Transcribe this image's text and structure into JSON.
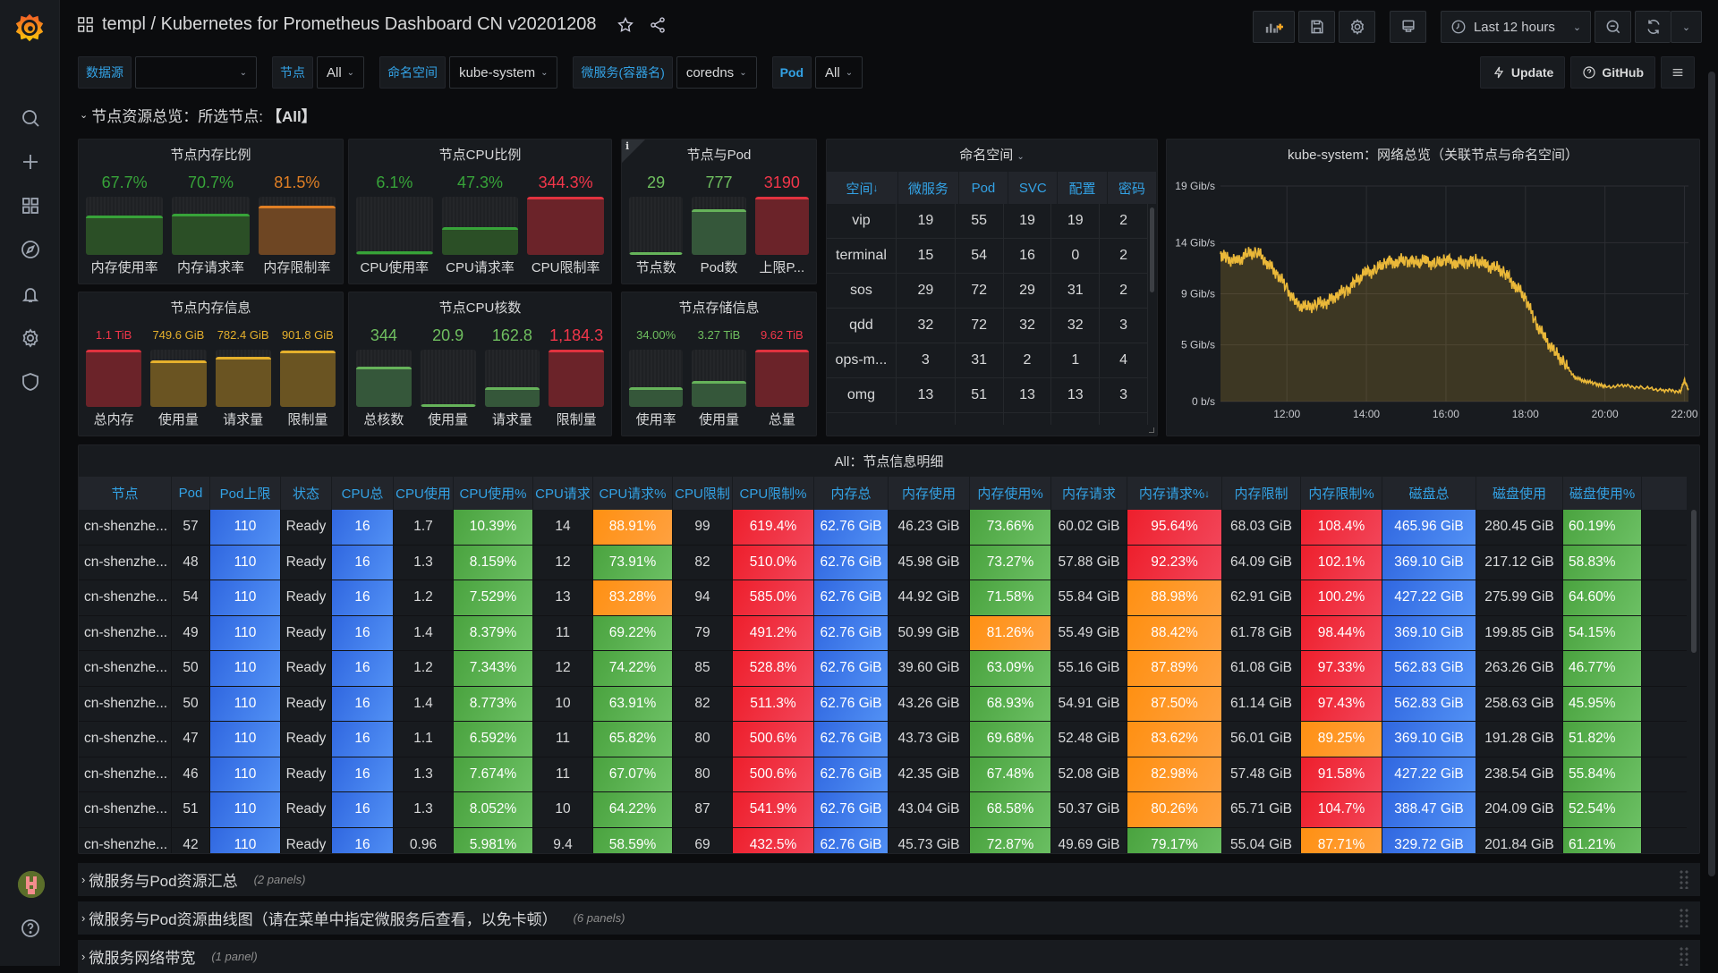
{
  "header": {
    "breadcrumb": "templ / Kubernetes for Prometheus Dashboard CN v20201208",
    "time_range": "Last 12 hours"
  },
  "sidebar": {
    "items": [
      "search",
      "create",
      "dashboards",
      "explore",
      "alerting",
      "configuration",
      "server-admin"
    ],
    "help": "help"
  },
  "variables": [
    {
      "label": "数据源",
      "value": ""
    },
    {
      "label": "节点",
      "value": "All"
    },
    {
      "label": "命名空间",
      "value": "kube-system"
    },
    {
      "label": "微服务(容器名)",
      "value": "coredns"
    },
    {
      "label": "Pod",
      "value": "All"
    }
  ],
  "links": {
    "update": "Update",
    "github": "GitHub"
  },
  "row": {
    "title_prefix": "节点资源总览：所选节点:",
    "title_value": "【All】"
  },
  "mem_ratio": {
    "title": "节点内存比例",
    "bars": [
      {
        "label": "内存使用率",
        "value": "67.7%",
        "fraction": 0.677,
        "color": "green"
      },
      {
        "label": "内存请求率",
        "value": "70.7%",
        "fraction": 0.707,
        "color": "green"
      },
      {
        "label": "内存限制率",
        "value": "81.5%",
        "fraction": 0.85,
        "color": "orange"
      }
    ]
  },
  "cpu_ratio": {
    "title": "节点CPU比例",
    "bars": [
      {
        "label": "CPU使用率",
        "value": "6.1%",
        "fraction": 0.061,
        "color": "green"
      },
      {
        "label": "CPU请求率",
        "value": "47.3%",
        "fraction": 0.473,
        "color": "green"
      },
      {
        "label": "CPU限制率",
        "value": "344.3%",
        "fraction": 1.0,
        "color": "red"
      }
    ]
  },
  "node_pod": {
    "title": "节点与Pod",
    "bars": [
      {
        "label": "节点数",
        "value": "29",
        "fraction": 0.02,
        "color": "green2"
      },
      {
        "label": "Pod数",
        "value": "777",
        "fraction": 0.78,
        "color": "green2"
      },
      {
        "label": "上限P...",
        "value": "3190",
        "fraction": 1.0,
        "color": "red"
      }
    ]
  },
  "mem_info": {
    "title": "节点内存信息",
    "bars": [
      {
        "label": "总内存",
        "value": "1.1 TiB",
        "fraction": 1.0,
        "color": "red"
      },
      {
        "label": "使用量",
        "value": "749.6 GiB",
        "fraction": 0.82,
        "color": "yellow"
      },
      {
        "label": "请求量",
        "value": "782.4 GiB",
        "fraction": 0.87,
        "color": "yellow"
      },
      {
        "label": "限制量",
        "value": "901.8 GiB",
        "fraction": 0.98,
        "color": "yellow"
      }
    ]
  },
  "cpu_cores": {
    "title": "节点CPU核数",
    "bars": [
      {
        "label": "总核数",
        "value": "344",
        "fraction": 0.71,
        "color": "green2"
      },
      {
        "label": "使用量",
        "value": "20.9",
        "fraction": 0.04,
        "color": "green2"
      },
      {
        "label": "请求量",
        "value": "162.8",
        "fraction": 0.34,
        "color": "green2"
      },
      {
        "label": "限制量",
        "value": "1,184.3",
        "fraction": 1.0,
        "color": "red"
      }
    ]
  },
  "storage": {
    "title": "节点存储信息",
    "bars": [
      {
        "label": "使用率",
        "value": "34.00%",
        "fraction": 0.34,
        "color": "green2"
      },
      {
        "label": "使用量",
        "value": "3.27 TiB",
        "fraction": 0.45,
        "color": "green2"
      },
      {
        "label": "总量",
        "value": "9.62 TiB",
        "fraction": 1.0,
        "color": "red"
      }
    ]
  },
  "namespace_table": {
    "title": "命名空间",
    "columns": [
      "空间",
      "微服务",
      "Pod",
      "SVC",
      "配置",
      "密码"
    ],
    "sort_column": "空间",
    "rows": [
      [
        "vip",
        "19",
        "55",
        "19",
        "19",
        "2"
      ],
      [
        "terminal",
        "15",
        "54",
        "16",
        "0",
        "2"
      ],
      [
        "sos",
        "29",
        "72",
        "29",
        "31",
        "2"
      ],
      [
        "qdd",
        "32",
        "72",
        "32",
        "32",
        "3"
      ],
      [
        "ops-m...",
        "3",
        "31",
        "2",
        "1",
        "4"
      ],
      [
        "omg",
        "13",
        "51",
        "13",
        "13",
        "3"
      ]
    ]
  },
  "chart_data": {
    "type": "area",
    "title": "kube-system：网络总览（关联节点与命名空间）",
    "xlabel": "",
    "ylabel": "",
    "x_ticks": [
      "12:00",
      "14:00",
      "16:00",
      "18:00",
      "20:00",
      "22:00"
    ],
    "y_ticks": [
      "0 b/s",
      "5 Gib/s",
      "9 Gib/s",
      "14 Gib/s",
      "19 Gib/s"
    ],
    "ylim": [
      0,
      19
    ],
    "xlim_hours": [
      10.33,
      22.1
    ],
    "grid": true,
    "legend": "none",
    "series": [
      {
        "name": "network",
        "color": "#eab839",
        "x_hours": [
          10.33,
          10.5,
          10.75,
          11.0,
          11.25,
          11.5,
          11.75,
          12.0,
          12.25,
          12.5,
          12.75,
          13.0,
          13.25,
          13.5,
          13.75,
          14.0,
          14.25,
          14.5,
          14.75,
          15.0,
          15.25,
          15.5,
          15.75,
          16.0,
          16.25,
          16.5,
          16.75,
          17.0,
          17.25,
          17.5,
          17.75,
          18.0,
          18.25,
          18.5,
          18.75,
          19.0,
          19.25,
          19.5,
          19.75,
          20.0,
          20.5,
          21.0,
          21.5,
          21.9,
          22.0,
          22.1
        ],
        "values": [
          13.0,
          12.6,
          12.3,
          13.0,
          13.2,
          12.3,
          11.3,
          10.0,
          8.5,
          8.3,
          8.6,
          8.8,
          9.4,
          9.8,
          10.6,
          11.4,
          11.6,
          12.4,
          12.3,
          12.5,
          12.2,
          12.4,
          12.1,
          12.6,
          12.2,
          12.3,
          12.4,
          12.0,
          11.8,
          11.3,
          10.2,
          9.2,
          7.0,
          5.5,
          4.3,
          3.3,
          2.1,
          1.8,
          1.6,
          1.3,
          1.4,
          1.2,
          1.0,
          0.9,
          1.9,
          1.0
        ]
      }
    ]
  },
  "node_table": {
    "title": "All：节点信息明细",
    "columns": [
      "节点",
      "Pod",
      "Pod上限",
      "状态",
      "CPU总",
      "CPU使用",
      "CPU使用%",
      "CPU请求",
      "CPU请求%",
      "CPU限制",
      "CPU限制%",
      "内存总",
      "内存使用",
      "内存使用%",
      "内存请求",
      "内存请求%",
      "内存限制",
      "内存限制%",
      "磁盘总",
      "磁盘使用",
      "磁盘使用%"
    ],
    "sort_column": "内存请求%",
    "rows": [
      [
        "cn-shenzhe...",
        "57",
        "110",
        "Ready",
        "16",
        "1.7",
        "10.39%",
        "14",
        "88.91%",
        "99",
        "619.4%",
        "62.76 GiB",
        "46.23 GiB",
        "73.66%",
        "60.02 GiB",
        "95.64%",
        "68.03 GiB",
        "108.4%",
        "465.96 GiB",
        "280.45 GiB",
        "60.19%"
      ],
      [
        "cn-shenzhe...",
        "48",
        "110",
        "Ready",
        "16",
        "1.3",
        "8.159%",
        "12",
        "73.91%",
        "82",
        "510.0%",
        "62.76 GiB",
        "45.98 GiB",
        "73.27%",
        "57.88 GiB",
        "92.23%",
        "64.09 GiB",
        "102.1%",
        "369.10 GiB",
        "217.12 GiB",
        "58.83%"
      ],
      [
        "cn-shenzhe...",
        "54",
        "110",
        "Ready",
        "16",
        "1.2",
        "7.529%",
        "13",
        "83.28%",
        "94",
        "585.0%",
        "62.76 GiB",
        "44.92 GiB",
        "71.58%",
        "55.84 GiB",
        "88.98%",
        "62.91 GiB",
        "100.2%",
        "427.22 GiB",
        "275.99 GiB",
        "64.60%"
      ],
      [
        "cn-shenzhe...",
        "49",
        "110",
        "Ready",
        "16",
        "1.4",
        "8.379%",
        "11",
        "69.22%",
        "79",
        "491.2%",
        "62.76 GiB",
        "50.99 GiB",
        "81.26%",
        "55.49 GiB",
        "88.42%",
        "61.78 GiB",
        "98.44%",
        "369.10 GiB",
        "199.85 GiB",
        "54.15%"
      ],
      [
        "cn-shenzhe...",
        "50",
        "110",
        "Ready",
        "16",
        "1.2",
        "7.343%",
        "12",
        "74.22%",
        "85",
        "528.8%",
        "62.76 GiB",
        "39.60 GiB",
        "63.09%",
        "55.16 GiB",
        "87.89%",
        "61.08 GiB",
        "97.33%",
        "562.83 GiB",
        "263.26 GiB",
        "46.77%"
      ],
      [
        "cn-shenzhe...",
        "50",
        "110",
        "Ready",
        "16",
        "1.4",
        "8.773%",
        "10",
        "63.91%",
        "82",
        "511.3%",
        "62.76 GiB",
        "43.26 GiB",
        "68.93%",
        "54.91 GiB",
        "87.50%",
        "61.14 GiB",
        "97.43%",
        "562.83 GiB",
        "258.63 GiB",
        "45.95%"
      ],
      [
        "cn-shenzhe...",
        "47",
        "110",
        "Ready",
        "16",
        "1.1",
        "6.592%",
        "11",
        "65.82%",
        "80",
        "500.6%",
        "62.76 GiB",
        "43.73 GiB",
        "69.68%",
        "52.48 GiB",
        "83.62%",
        "56.01 GiB",
        "89.25%",
        "369.10 GiB",
        "191.28 GiB",
        "51.82%"
      ],
      [
        "cn-shenzhe...",
        "46",
        "110",
        "Ready",
        "16",
        "1.3",
        "7.674%",
        "11",
        "67.07%",
        "80",
        "500.6%",
        "62.76 GiB",
        "42.35 GiB",
        "67.48%",
        "52.08 GiB",
        "82.98%",
        "57.48 GiB",
        "91.58%",
        "427.22 GiB",
        "238.54 GiB",
        "55.84%"
      ],
      [
        "cn-shenzhe...",
        "51",
        "110",
        "Ready",
        "16",
        "1.3",
        "8.052%",
        "10",
        "64.22%",
        "87",
        "541.9%",
        "62.76 GiB",
        "43.04 GiB",
        "68.58%",
        "50.37 GiB",
        "80.26%",
        "65.71 GiB",
        "104.7%",
        "388.47 GiB",
        "204.09 GiB",
        "52.54%"
      ],
      [
        "cn-shenzhe...",
        "42",
        "110",
        "Ready",
        "16",
        "0.96",
        "5.981%",
        "9.4",
        "58.59%",
        "69",
        "432.5%",
        "62.76 GiB",
        "45.73 GiB",
        "72.87%",
        "49.69 GiB",
        "79.17%",
        "55.04 GiB",
        "87.71%",
        "329.72 GiB",
        "201.84 GiB",
        "61.21%"
      ]
    ],
    "cell_colors": [
      [
        "",
        "",
        "blue",
        "",
        "blue",
        "",
        "green",
        "",
        "orange",
        "",
        "red",
        "blue",
        "",
        "green",
        "",
        "red",
        "",
        "red",
        "blue",
        "",
        "green"
      ],
      [
        "",
        "",
        "blue",
        "",
        "blue",
        "",
        "green",
        "",
        "green",
        "",
        "red",
        "blue",
        "",
        "green",
        "",
        "red",
        "",
        "red",
        "blue",
        "",
        "green"
      ],
      [
        "",
        "",
        "blue",
        "",
        "blue",
        "",
        "green",
        "",
        "orange",
        "",
        "red",
        "blue",
        "",
        "green",
        "",
        "orange",
        "",
        "red",
        "blue",
        "",
        "green"
      ],
      [
        "",
        "",
        "blue",
        "",
        "blue",
        "",
        "green",
        "",
        "green",
        "",
        "red",
        "blue",
        "",
        "orange",
        "",
        "orange",
        "",
        "red",
        "blue",
        "",
        "green"
      ],
      [
        "",
        "",
        "blue",
        "",
        "blue",
        "",
        "green",
        "",
        "green",
        "",
        "red",
        "blue",
        "",
        "green",
        "",
        "orange",
        "",
        "red",
        "blue",
        "",
        "green"
      ],
      [
        "",
        "",
        "blue",
        "",
        "blue",
        "",
        "green",
        "",
        "green",
        "",
        "red",
        "blue",
        "",
        "green",
        "",
        "orange",
        "",
        "red",
        "blue",
        "",
        "green"
      ],
      [
        "",
        "",
        "blue",
        "",
        "blue",
        "",
        "green",
        "",
        "green",
        "",
        "red",
        "blue",
        "",
        "green",
        "",
        "orange",
        "",
        "orange",
        "blue",
        "",
        "green"
      ],
      [
        "",
        "",
        "blue",
        "",
        "blue",
        "",
        "green",
        "",
        "green",
        "",
        "red",
        "blue",
        "",
        "green",
        "",
        "orange",
        "",
        "red",
        "blue",
        "",
        "green"
      ],
      [
        "",
        "",
        "blue",
        "",
        "blue",
        "",
        "green",
        "",
        "green",
        "",
        "red",
        "blue",
        "",
        "green",
        "",
        "orange",
        "",
        "red",
        "blue",
        "",
        "green"
      ],
      [
        "",
        "",
        "blue",
        "",
        "blue",
        "",
        "green",
        "",
        "green",
        "",
        "red",
        "blue",
        "",
        "green",
        "",
        "green",
        "",
        "orange",
        "blue",
        "",
        "green"
      ]
    ]
  },
  "collapsed_rows": [
    {
      "title": "微服务与Pod资源汇总",
      "count": "(2 panels)"
    },
    {
      "title": "微服务与Pod资源曲线图（请在菜单中指定微服务后查看，以免卡顿）",
      "count": "(6 panels)"
    },
    {
      "title": "微服务网络带宽",
      "count": "(1 panel)"
    }
  ]
}
